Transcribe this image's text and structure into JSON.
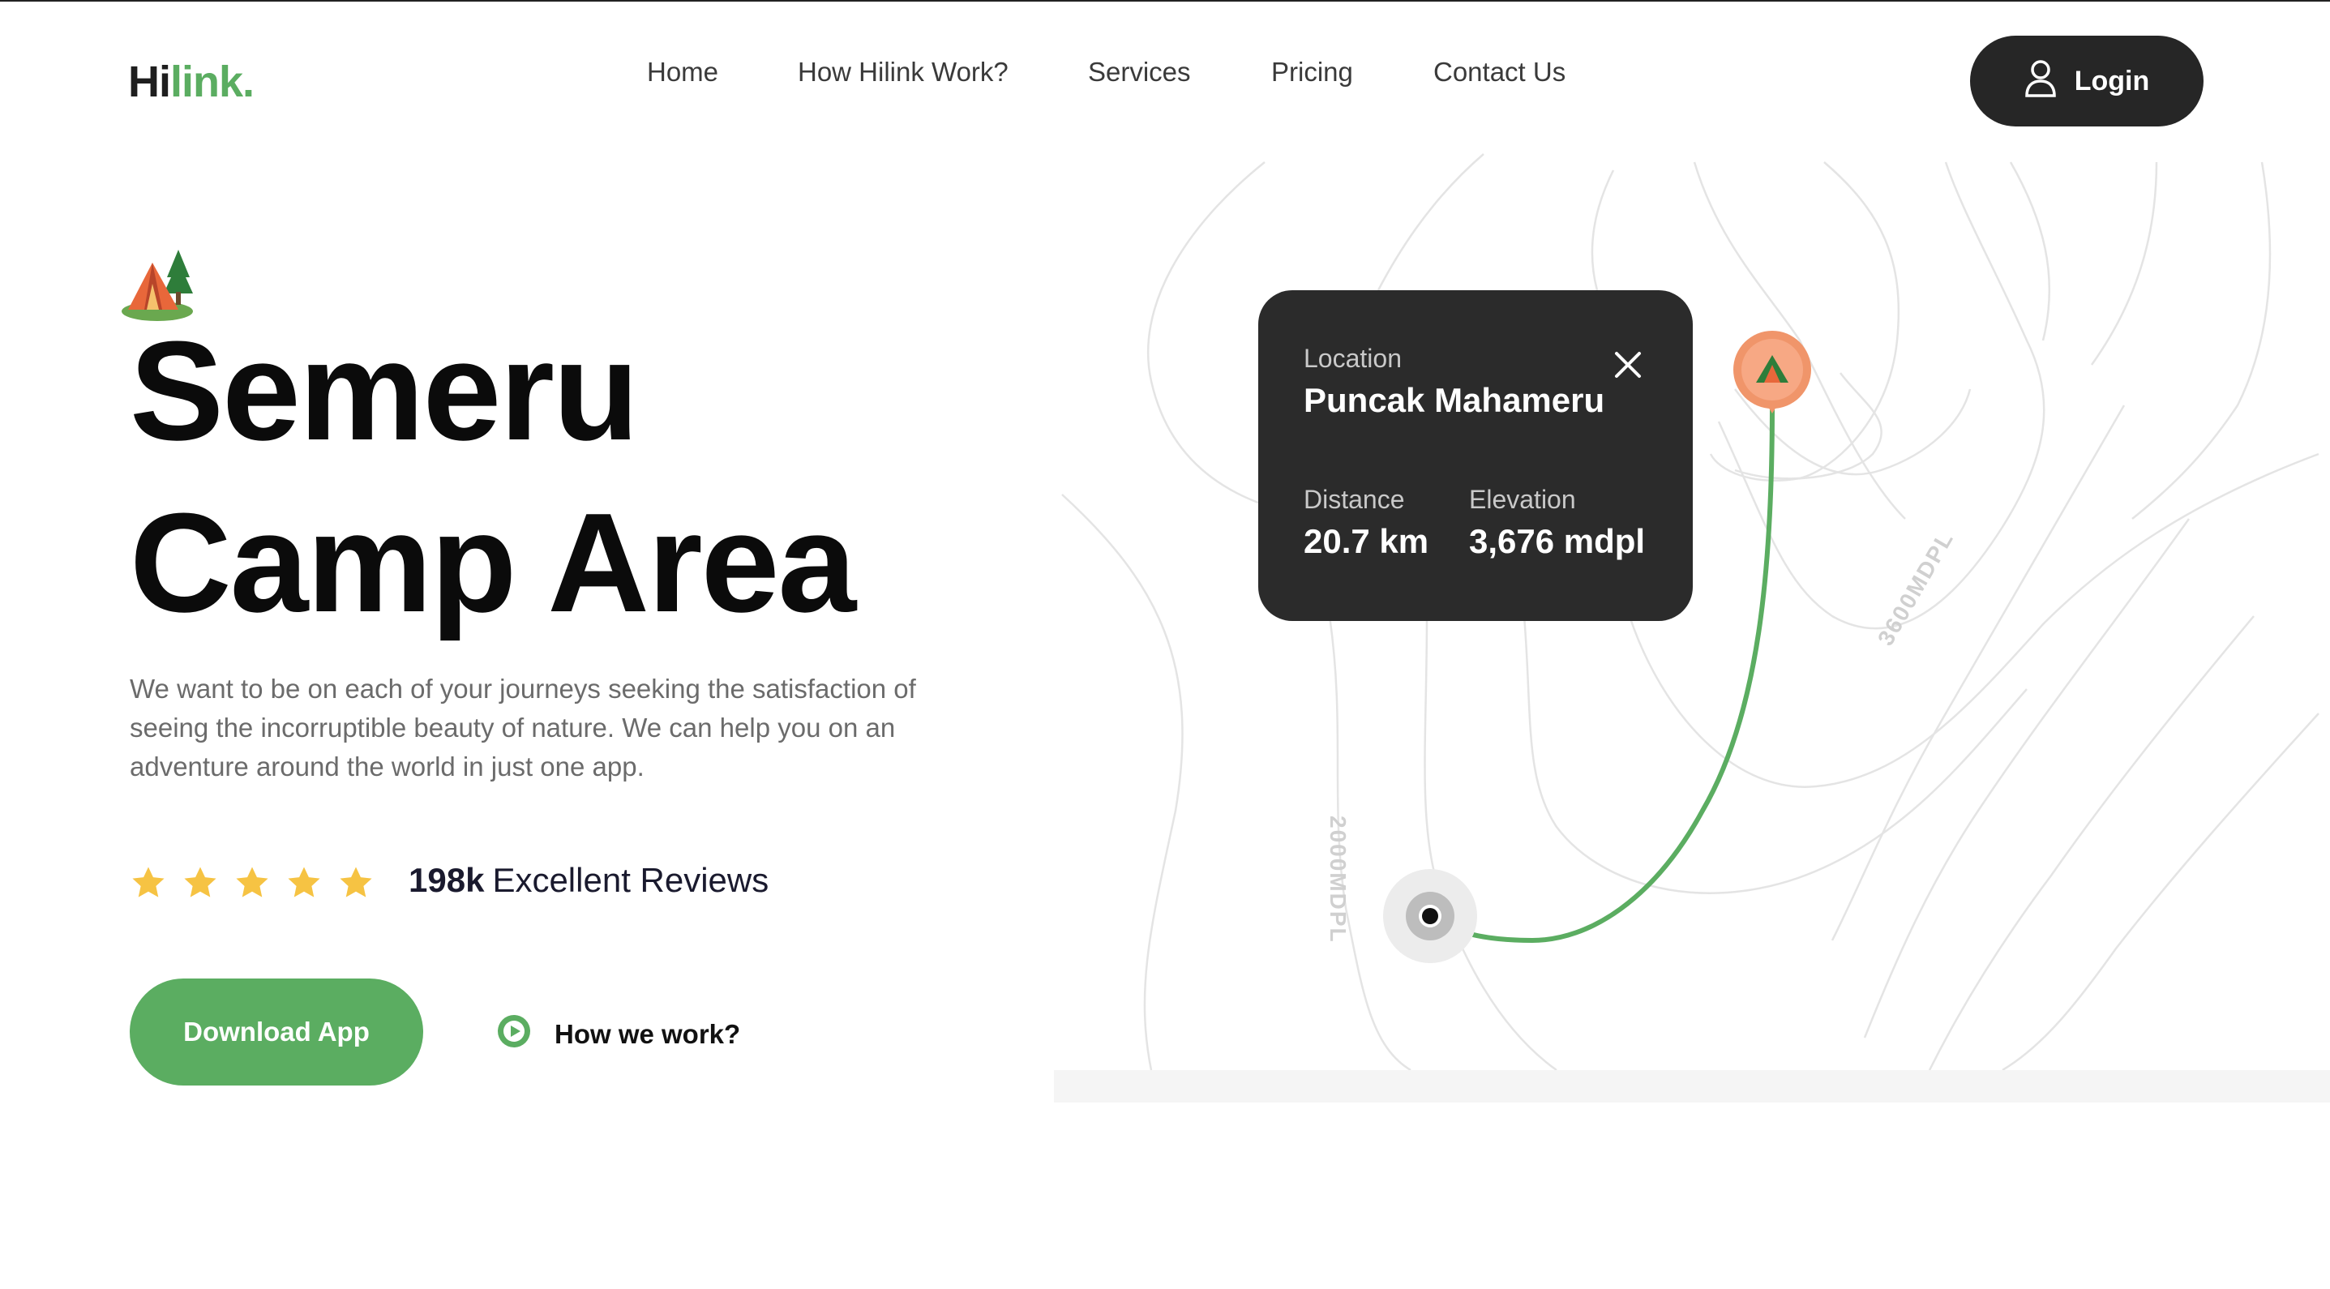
{
  "header": {
    "logo_part1": "Hi",
    "logo_part2": "link.",
    "nav": [
      "Home",
      "How Hilink Work?",
      "Services",
      "Pricing",
      "Contact Us"
    ],
    "login_label": "Login"
  },
  "hero": {
    "title_line1": "Semeru",
    "title_line2": "Camp Area",
    "description": "We want to be on each of your journeys seeking the satisfaction of seeing the incorruptible beauty of nature. We can help you on an adventure around the world in just one app.",
    "rating_stars": 5,
    "reviews_count": "198k",
    "reviews_label": "Excellent Reviews",
    "download_label": "Download App",
    "how_label": "How we work?"
  },
  "map": {
    "card": {
      "location_label": "Location",
      "location_value": "Puncak Mahameru",
      "distance_label": "Distance",
      "distance_value": "20.7 km",
      "elevation_label": "Elevation",
      "elevation_value": "3,676 mdpl"
    },
    "contour_label_1": "2000MDPL",
    "contour_label_2": "3600MDPL"
  },
  "colors": {
    "accent": "#5bad61",
    "dark": "#262626",
    "star": "#f6c343",
    "pin": "#f0956a"
  },
  "icons": [
    "user-icon",
    "close-icon",
    "star-icon",
    "play-circle-icon",
    "tent-icon",
    "map-pin-icon"
  ]
}
